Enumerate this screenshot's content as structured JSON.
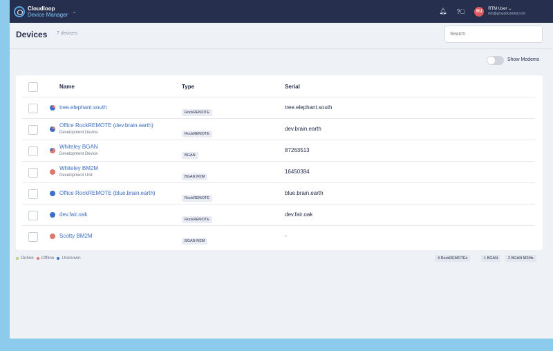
{
  "app": {
    "logo_line1": "Cloudloop",
    "logo_line2": "Device Manager"
  },
  "user": {
    "initials": "RU",
    "name": "RTM User",
    "email": "rtm@groundcontrol.com"
  },
  "page": {
    "title": "Devices",
    "count": "7 devices",
    "search_placeholder": "Search",
    "toggle_label": "Show Modems"
  },
  "table": {
    "headers": {
      "name": "Name",
      "type": "Type",
      "serial": "Serial"
    },
    "rows": [
      {
        "name": "tree.elephant.south",
        "sub": "",
        "type": "RockREMOTE",
        "serial": "tree.elephant.south",
        "status": "mixed"
      },
      {
        "name": "Office RockREMOTE (dev.brain.earth)",
        "sub": "Development Device",
        "type": "RockREMOTE",
        "serial": "dev.brain.earth",
        "status": "mixed"
      },
      {
        "name": "Whiteley BGAN",
        "sub": "Development Device",
        "type": "BGAN",
        "serial": "87263513",
        "status": "mixed-red"
      },
      {
        "name": "Whiteley BM2M",
        "sub": "Development Unit",
        "type": "BGAN M2M",
        "serial": "16450384",
        "status": "offline"
      },
      {
        "name": "Office RockREMOTE (blue.brain.earth)",
        "sub": "",
        "type": "RockREMOTE",
        "serial": "blue.brain.earth",
        "status": "unknown"
      },
      {
        "name": "dev.fair.oak",
        "sub": "",
        "type": "RockREMOTE",
        "serial": "dev.fair.oak",
        "status": "unknown"
      },
      {
        "name": "Scotty BM2M",
        "sub": "",
        "type": "BGAN M2M",
        "serial": "-",
        "status": "offline"
      }
    ]
  },
  "legend": {
    "online": "Online",
    "offline": "Offline",
    "unknown": "Unknown"
  },
  "summary": {
    "rockremote": "4 RockREMOTEs",
    "bgan": "1 BGAN",
    "bgan_m2m": "2 BGAN M2Ms"
  },
  "colors": {
    "online": "#b8d36a",
    "offline": "#e2766a",
    "unknown": "#3a6fd0",
    "navbar": "#262f4d"
  }
}
